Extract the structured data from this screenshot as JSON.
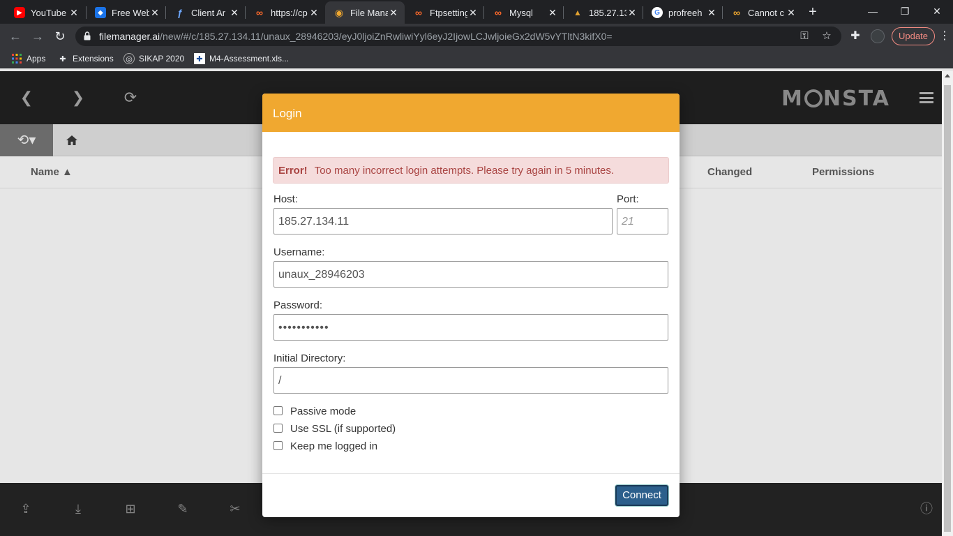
{
  "browser": {
    "tabs": [
      {
        "label": "YouTube",
        "fav": "▶",
        "fav_bg": "#ff0000",
        "fav_fg": "#ffffff"
      },
      {
        "label": "Free Web",
        "fav": "◆",
        "fav_bg": "#1a73e8",
        "fav_fg": "#ffffff"
      },
      {
        "label": "Client Ar",
        "fav": "ƒ",
        "fav_bg": "transparent",
        "fav_fg": "#6ea8fe"
      },
      {
        "label": "https://cp",
        "fav": "∞",
        "fav_bg": "transparent",
        "fav_fg": "#ff6a2b"
      },
      {
        "label": "File Mana",
        "fav": "◉",
        "fav_bg": "transparent",
        "fav_fg": "#f0a830"
      },
      {
        "label": "Ftpsetting",
        "fav": "∞",
        "fav_bg": "transparent",
        "fav_fg": "#ff6a2b"
      },
      {
        "label": "Mysql",
        "fav": "∞",
        "fav_bg": "transparent",
        "fav_fg": "#ff6a2b"
      },
      {
        "label": "185.27.13",
        "fav": "▲",
        "fav_bg": "transparent",
        "fav_fg": "#e0a030"
      },
      {
        "label": "profreeh",
        "fav": "G",
        "fav_bg": "#ffffff",
        "fav_fg": "#4285f4"
      },
      {
        "label": "Cannot c",
        "fav": "∞",
        "fav_bg": "transparent",
        "fav_fg": "#f0a830"
      }
    ],
    "active_tab": 4,
    "url_host": "filemanager.ai",
    "url_path": "/new/#/c/185.27.134.11/unaux_28946203/eyJ0ljoiZnRwliwiYyl6eyJ2IjowLCJwljoieGx2dW5vYTltN3kifX0=",
    "update_label": "Update",
    "bookmarks": [
      {
        "label": "Apps",
        "icon": "apps-grid-icon"
      },
      {
        "label": "Extensions",
        "icon": "puzzle-icon"
      },
      {
        "label": "SIKAP 2020",
        "icon": "globe-icon"
      },
      {
        "label": "M4-Assessment.xls...",
        "icon": "flag-icon"
      }
    ]
  },
  "app": {
    "columns": {
      "name": "Name ▲",
      "changed": "Changed",
      "permissions": "Permissions"
    },
    "accent": "#f0a830"
  },
  "modal": {
    "title": "Login",
    "error_label": "Error!",
    "error_text": "Too many incorrect login attempts. Please try again in 5 minutes.",
    "host_label": "Host:",
    "host_value": "185.27.134.11",
    "port_label": "Port:",
    "port_placeholder": "21",
    "username_label": "Username:",
    "username_value": "unaux_28946203",
    "password_label": "Password:",
    "password_value": "•••••••••••",
    "initdir_label": "Initial Directory:",
    "initdir_value": "/",
    "options": [
      "Passive mode",
      "Use SSL (if supported)",
      "Keep me logged in"
    ],
    "connect_label": "Connect"
  }
}
